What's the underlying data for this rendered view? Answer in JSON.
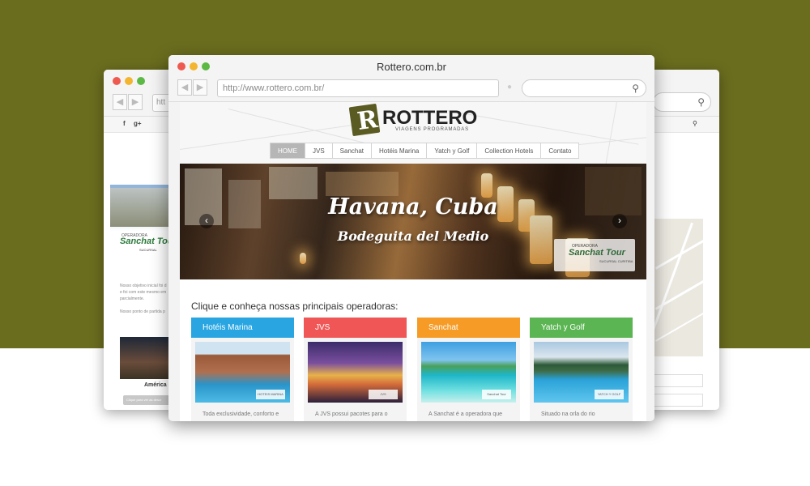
{
  "window": {
    "title": "Rottero.com.br",
    "url": "http://www.rottero.com.br/",
    "back_url_fragment": "htt"
  },
  "logo": {
    "name": "ROTTERO",
    "letter": "R",
    "tagline": "VIAGENS PROGRAMADAS"
  },
  "menu": [
    {
      "label": "HOME",
      "active": true
    },
    {
      "label": "JVS",
      "active": false
    },
    {
      "label": "Sanchat",
      "active": false
    },
    {
      "label": "Hotéis Marina",
      "active": false
    },
    {
      "label": "Yatch y Golf",
      "active": false
    },
    {
      "label": "Collection Hotels",
      "active": false
    },
    {
      "label": "Contato",
      "active": false
    }
  ],
  "hero": {
    "title": "Havana, Cuba",
    "subtitle": "Bodeguita del Medio",
    "prev_symbol": "‹",
    "next_symbol": "›",
    "badge": {
      "operator": "OPERADORA",
      "name": "Sanchat Tour",
      "branch": "SUCURSAL CURITIBA"
    }
  },
  "section_title": "Clique e conheça nossas principais operadoras:",
  "cards": [
    {
      "title": "Hotéis Marina",
      "color": "#29a6e2",
      "text": "Toda exclusividade, conforto e",
      "logo": "HOTEIS MARINA"
    },
    {
      "title": "JVS",
      "color": "#f05656",
      "text": "A JVS possui pacotes para o",
      "logo": "JVS"
    },
    {
      "title": "Sanchat",
      "color": "#f59b26",
      "text": "A Sanchat é a operadora que",
      "logo": "Sanchat Tour"
    },
    {
      "title": "Yatch y Golf",
      "color": "#5ab552",
      "text": "Situado na orla do rio",
      "logo": "YATCH Y GOLF"
    }
  ],
  "back_window": {
    "social": [
      "f",
      "g+"
    ],
    "banner": {
      "operator": "OPERADORA",
      "name": "Sanchat Tour",
      "branch": "SUCURSAL"
    },
    "text_lines": [
      "Nosso objetivo inicial foi d",
      "e foi com este mesmo em",
      "parcialmente.",
      "Nosso ponto de partida p"
    ],
    "caption": "América d",
    "button": "Clique para ver as descr"
  },
  "colors": {
    "background_band": "#6a6d1e",
    "menu_active": "#b6b6b6"
  },
  "icons": {
    "search": "magnifier-icon",
    "nav_back": "left-arrow-icon",
    "nav_forward": "right-arrow-icon"
  }
}
